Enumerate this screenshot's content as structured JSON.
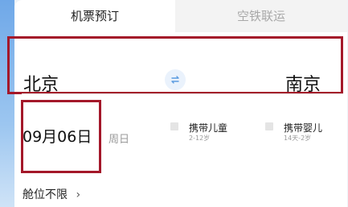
{
  "tabs": [
    {
      "label": "机票预订",
      "active": true
    },
    {
      "label": "空铁联运",
      "active": false
    }
  ],
  "route": {
    "from_city": "北京",
    "to_city": "南京",
    "swap_icon": "swap-arrows-icon"
  },
  "date": {
    "value": "09月06日",
    "weekday": "周日"
  },
  "passengers": {
    "child": {
      "label": "携带儿童",
      "age_range": "2-12岁",
      "checked": false
    },
    "infant": {
      "label": "携带婴儿",
      "age_range": "14天-2岁",
      "checked": false
    }
  },
  "cabin": {
    "label": "舱位不限",
    "chevron": "›"
  },
  "colors": {
    "highlight_border": "#a4182a",
    "accent_blue": "#5b9be0",
    "inactive_tab_text": "#a8a8a8"
  }
}
